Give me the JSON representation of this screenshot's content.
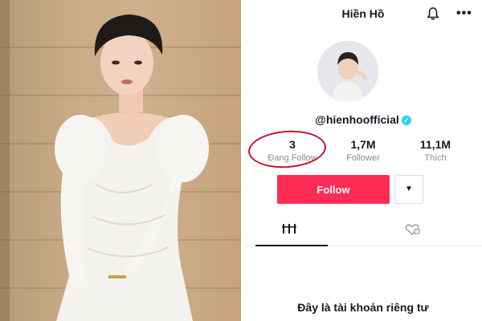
{
  "header": {
    "username": "Hiền Hồ",
    "notifications_icon": "bell-icon",
    "more_icon": "more-options-icon",
    "more_label": "•••"
  },
  "profile": {
    "handle": "@hienhoofficial",
    "verified_mark": "✓"
  },
  "stats": {
    "following_count": "3",
    "following_label": "Đang Follow",
    "followers_count": "1,7M",
    "followers_label": "Follower",
    "likes_count": "11,1M",
    "likes_label": "Thích"
  },
  "actions": {
    "follow_label": "Follow",
    "dropdown_label": "▼"
  },
  "tabs": {
    "videos_icon": "videos-grid-icon",
    "liked_icon": "liked-videos-icon"
  },
  "body": {
    "private_notice": "Đây là tài khoản riêng tư"
  },
  "colors": {
    "accent": "#fe2c55",
    "highlight_circle": "#c8102e",
    "verified": "#20d5ec"
  }
}
